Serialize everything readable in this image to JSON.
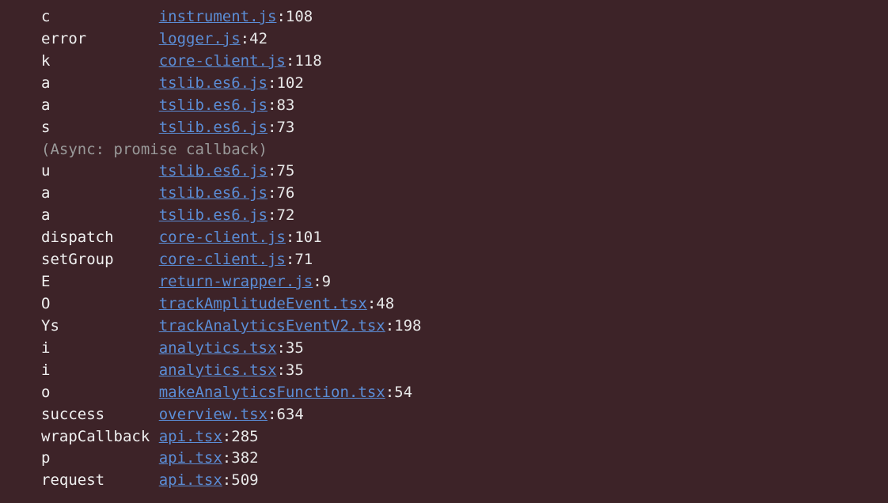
{
  "stack": [
    {
      "type": "frame",
      "func": "c",
      "file": "instrument.js",
      "line": "108"
    },
    {
      "type": "frame",
      "func": "error",
      "file": "logger.js",
      "line": "42"
    },
    {
      "type": "frame",
      "func": "k",
      "file": "core-client.js",
      "line": "118"
    },
    {
      "type": "frame",
      "func": "a",
      "file": "tslib.es6.js",
      "line": "102"
    },
    {
      "type": "frame",
      "func": "a",
      "file": "tslib.es6.js",
      "line": "83"
    },
    {
      "type": "frame",
      "func": "s",
      "file": "tslib.es6.js",
      "line": "73"
    },
    {
      "type": "async",
      "label": "(Async: promise callback)"
    },
    {
      "type": "frame",
      "func": "u",
      "file": "tslib.es6.js",
      "line": "75"
    },
    {
      "type": "frame",
      "func": "a",
      "file": "tslib.es6.js",
      "line": "76"
    },
    {
      "type": "frame",
      "func": "a",
      "file": "tslib.es6.js",
      "line": "72"
    },
    {
      "type": "frame",
      "func": "dispatch",
      "file": "core-client.js",
      "line": "101"
    },
    {
      "type": "frame",
      "func": "setGroup",
      "file": "core-client.js",
      "line": "71"
    },
    {
      "type": "frame",
      "func": "E",
      "file": "return-wrapper.js",
      "line": "9"
    },
    {
      "type": "frame",
      "func": "O",
      "file": "trackAmplitudeEvent.tsx",
      "line": "48"
    },
    {
      "type": "frame",
      "func": "Ys",
      "file": "trackAnalyticsEventV2.tsx",
      "line": "198"
    },
    {
      "type": "frame",
      "func": "i",
      "file": "analytics.tsx",
      "line": "35"
    },
    {
      "type": "frame",
      "func": "i",
      "file": "analytics.tsx",
      "line": "35"
    },
    {
      "type": "frame",
      "func": "o",
      "file": "makeAnalyticsFunction.tsx",
      "line": "54"
    },
    {
      "type": "frame",
      "func": "success",
      "file": "overview.tsx",
      "line": "634"
    },
    {
      "type": "frame",
      "func": "wrapCallback",
      "file": "api.tsx",
      "line": "285"
    },
    {
      "type": "frame",
      "func": "p",
      "file": "api.tsx",
      "line": "382"
    },
    {
      "type": "frame",
      "func": "request",
      "file": "api.tsx",
      "line": "509"
    }
  ]
}
